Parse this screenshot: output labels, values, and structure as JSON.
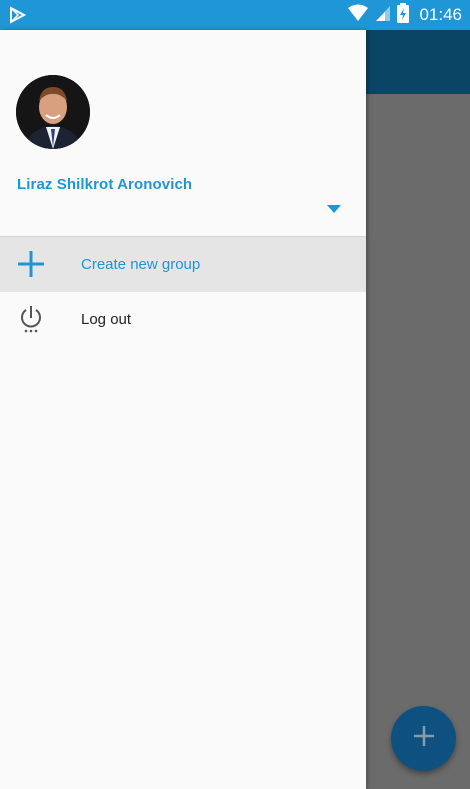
{
  "status_bar": {
    "time": "01:46",
    "icons": [
      "play-store-icon",
      "wifi-icon",
      "signal-icon",
      "battery-charging-icon"
    ]
  },
  "drawer": {
    "user": {
      "name": "Liraz Shilkrot Aronovich",
      "avatar": "profile-photo"
    },
    "account_switch_icon": "dropdown-arrow-icon",
    "menu": [
      {
        "label": "Create new group",
        "icon": "plus-icon",
        "selected": true
      },
      {
        "label": "Log out",
        "icon": "power-icon",
        "selected": false
      }
    ]
  },
  "fab": {
    "icon": "plus-icon"
  },
  "colors": {
    "accent": "#1e96d4",
    "status_bar": "#1f97d6",
    "scrim": "#6b6b6b",
    "fab": "#0e5180"
  }
}
